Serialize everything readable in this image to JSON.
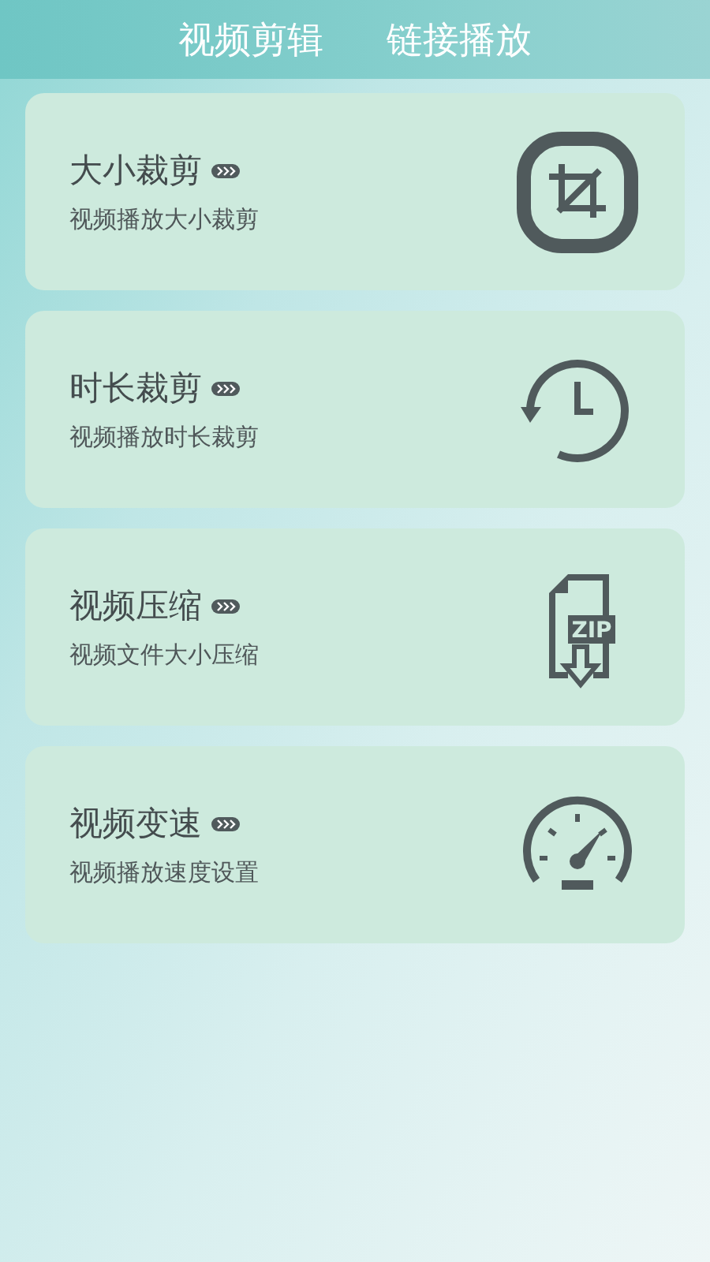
{
  "tabs": [
    {
      "label": "视频剪辑"
    },
    {
      "label": "链接播放"
    }
  ],
  "cards": [
    {
      "kind": "crop",
      "title": "大小裁剪",
      "subtitle": "视频播放大小裁剪"
    },
    {
      "kind": "clock",
      "title": "时长裁剪",
      "subtitle": "视频播放时长裁剪"
    },
    {
      "kind": "zip",
      "title": "视频压缩",
      "subtitle": "视频文件大小压缩",
      "icon_text": "ZIP"
    },
    {
      "kind": "gauge",
      "title": "视频变速",
      "subtitle": "视频播放速度设置"
    }
  ]
}
